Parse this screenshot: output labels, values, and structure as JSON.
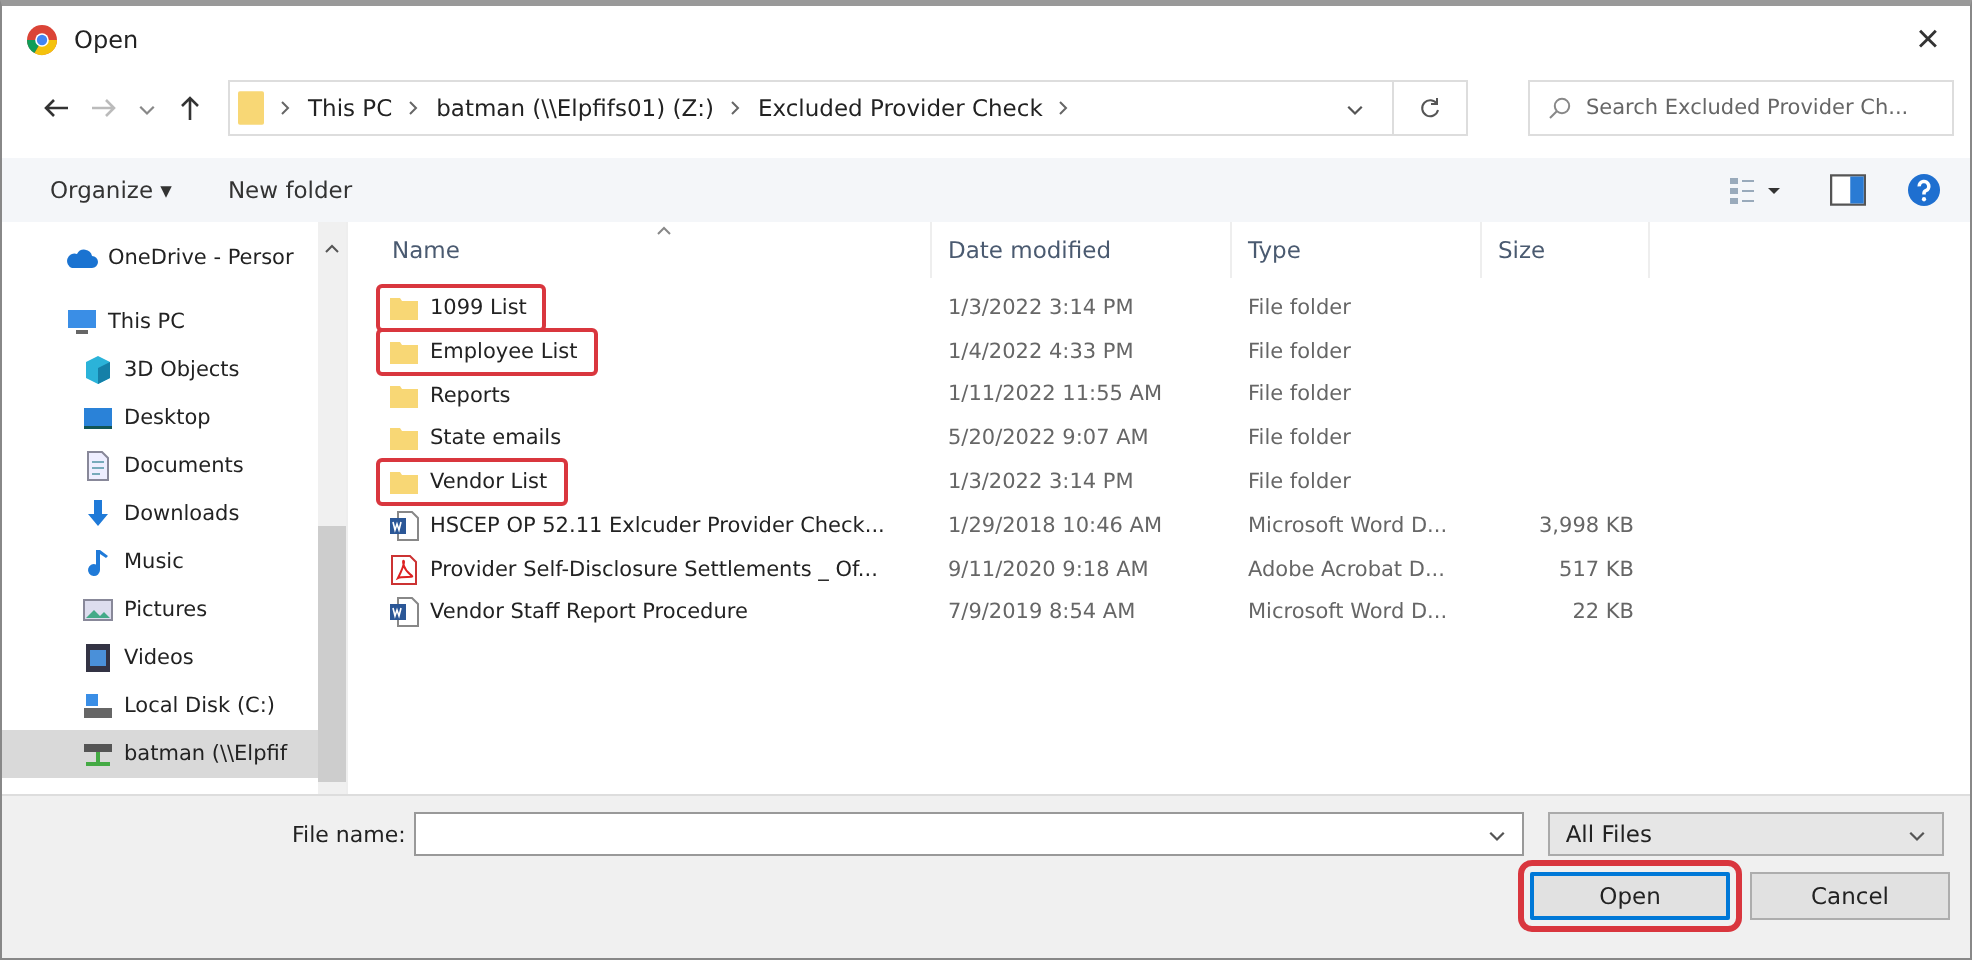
{
  "window": {
    "title": "Open",
    "close": "×"
  },
  "address": {
    "crumbs": [
      "This PC",
      "batman (\\\\Elpfifs01) (Z:)",
      "Excluded Provider Check"
    ]
  },
  "search": {
    "placeholder": "Search Excluded Provider Ch..."
  },
  "toolbar": {
    "organize": "Organize ▾",
    "new_folder": "New folder"
  },
  "sidebar": {
    "items": [
      {
        "label": "OneDrive - Persor",
        "kind": "cloud",
        "selected": false
      },
      {
        "label": "This PC",
        "kind": "pc",
        "selected": false,
        "children": [
          {
            "label": "3D Objects",
            "kind": "cube",
            "selected": false
          },
          {
            "label": "Desktop",
            "kind": "desktop",
            "selected": false
          },
          {
            "label": "Documents",
            "kind": "documents",
            "selected": false
          },
          {
            "label": "Downloads",
            "kind": "downloads",
            "selected": false
          },
          {
            "label": "Music",
            "kind": "music",
            "selected": false
          },
          {
            "label": "Pictures",
            "kind": "pictures",
            "selected": false
          },
          {
            "label": "Videos",
            "kind": "videos",
            "selected": false
          },
          {
            "label": "Local Disk (C:)",
            "kind": "disk",
            "selected": false
          },
          {
            "label": "batman (\\\\Elpfif",
            "kind": "netdrive",
            "selected": true
          }
        ]
      }
    ]
  },
  "table": {
    "columns": [
      "Name",
      "Date modified",
      "Type",
      "Size"
    ],
    "rows": [
      {
        "name": "1099 List",
        "date": "1/3/2022 3:14 PM",
        "type": "File folder",
        "kind": "folder",
        "highlighted": true
      },
      {
        "name": "Employee List",
        "date": "1/4/2022 4:33 PM",
        "type": "File folder",
        "kind": "folder",
        "highlighted": true
      },
      {
        "name": "Reports",
        "date": "1/11/2022 11:55 AM",
        "type": "File folder",
        "kind": "folder",
        "highlighted": false
      },
      {
        "name": "State emails",
        "date": "5/20/2022 9:07 AM",
        "type": "File folder",
        "kind": "folder",
        "highlighted": false
      },
      {
        "name": "Vendor List",
        "date": "1/3/2022 3:14 PM",
        "type": "File folder",
        "kind": "folder",
        "highlighted": true
      },
      {
        "name": "HSCEP OP 52.11 Exlcuder Provider Check...",
        "date": "1/29/2018 10:46 AM",
        "type": "Microsoft Word D...",
        "size": "3,998 KB",
        "kind": "word",
        "highlighted": false
      },
      {
        "name": "Provider Self-Disclosure Settlements _ Of...",
        "date": "9/11/2020 9:18 AM",
        "type": "Adobe Acrobat D...",
        "size": "517 KB",
        "kind": "pdf",
        "highlighted": false
      },
      {
        "name": "Vendor Staff Report Procedure",
        "date": "7/9/2019 8:54 AM",
        "type": "Microsoft Word D...",
        "size": "22 KB",
        "kind": "word",
        "highlighted": false
      }
    ]
  },
  "footer": {
    "file_name_label": "File name:",
    "filter": "All Files",
    "open": "Open",
    "open_highlighted": true,
    "cancel": "Cancel"
  }
}
